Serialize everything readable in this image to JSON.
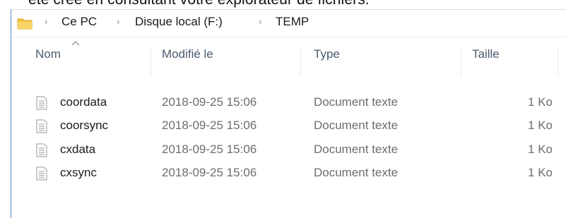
{
  "caption_cut": "été créé en consultant votre explorateur de fichiers.",
  "breadcrumb": {
    "items": [
      "Ce PC",
      "Disque local (F:)",
      "TEMP"
    ],
    "separator": "›"
  },
  "columns": {
    "name": "Nom",
    "modified": "Modifié le",
    "type": "Type",
    "size": "Taille"
  },
  "files": [
    {
      "name": "coordata",
      "modified": "2018-09-25 15:06",
      "type": "Document texte",
      "size": "1 Ko"
    },
    {
      "name": "coorsync",
      "modified": "2018-09-25 15:06",
      "type": "Document texte",
      "size": "1 Ko"
    },
    {
      "name": "cxdata",
      "modified": "2018-09-25 15:06",
      "type": "Document texte",
      "size": "1 Ko"
    },
    {
      "name": "cxsync",
      "modified": "2018-09-25 15:06",
      "type": "Document texte",
      "size": "1 Ko"
    }
  ],
  "icons": {
    "folder": "folder-icon",
    "file": "text-file-icon",
    "sort": "sort-up-icon"
  },
  "colors": {
    "folder_yellow": "#f3c647",
    "window_left_border": "#5b8bc4",
    "header_text": "#4b5b6e"
  }
}
